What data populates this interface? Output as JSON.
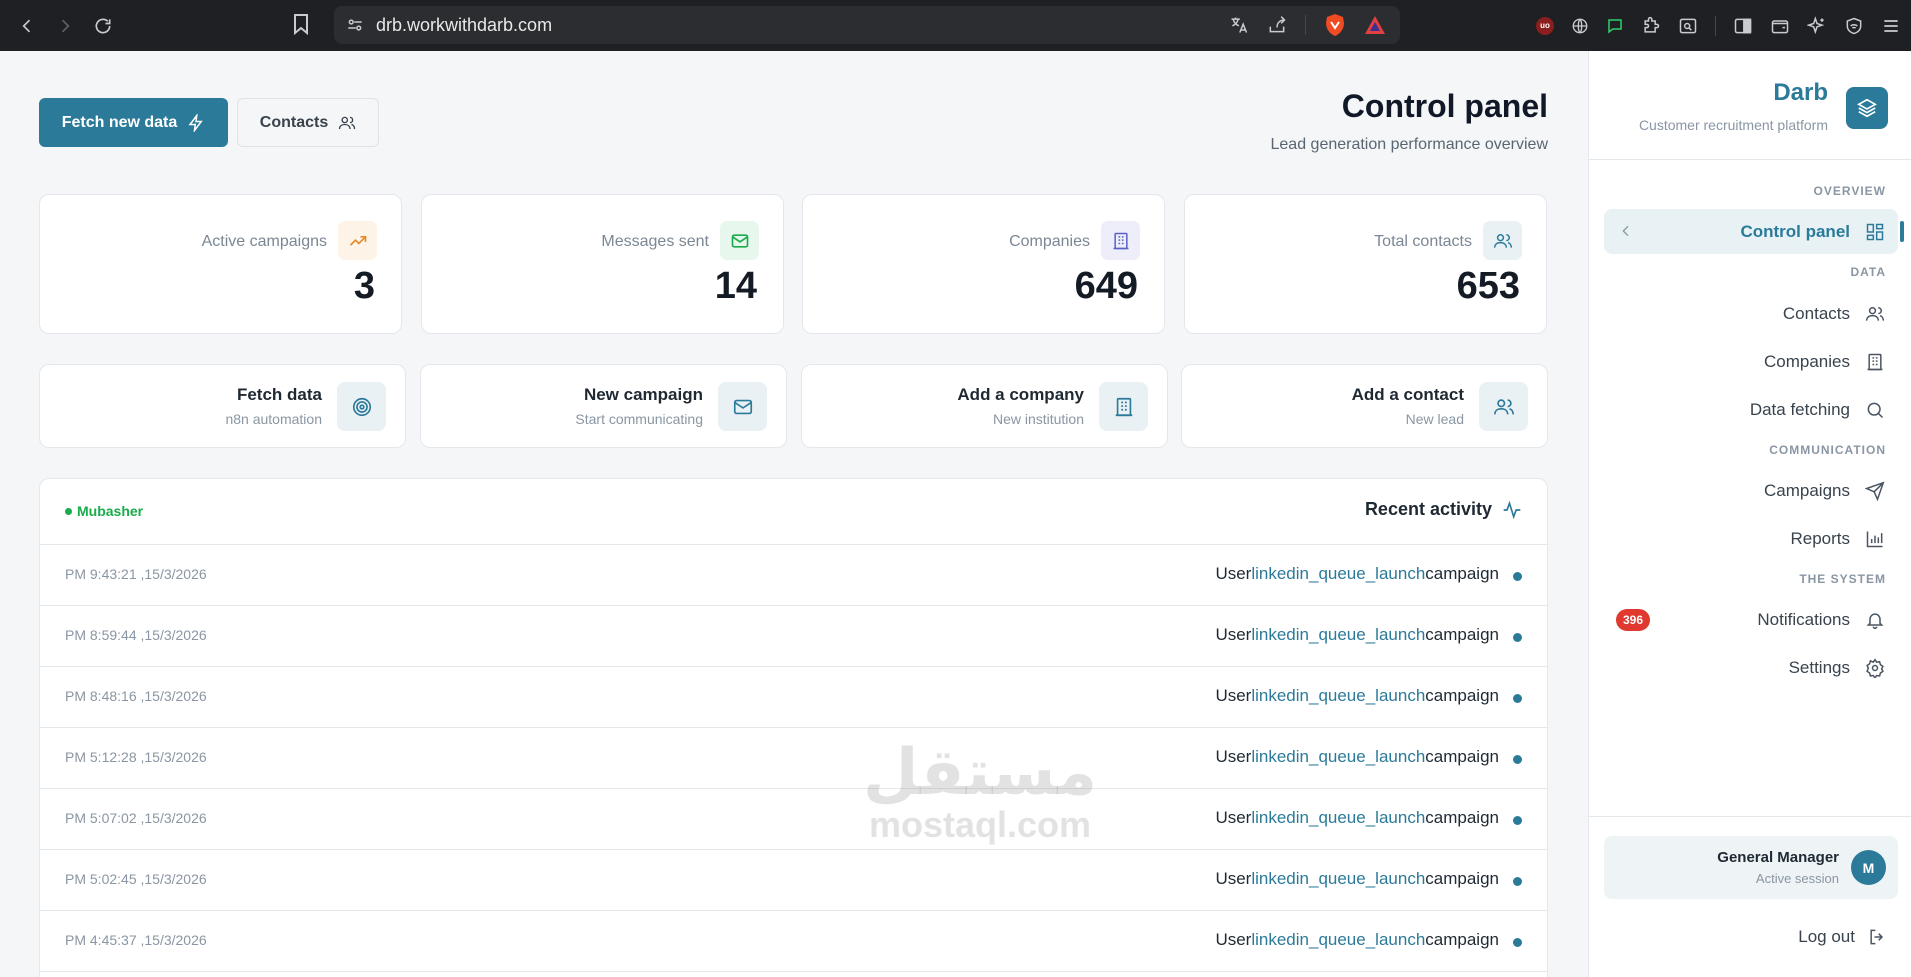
{
  "browser": {
    "url": "drb.workwithdarb.com",
    "extension_badge": "uo"
  },
  "toolbar": {
    "fetch_label": "Fetch new data",
    "contacts_label": "Contacts"
  },
  "header": {
    "title": "Control panel",
    "subtitle": "Lead generation performance overview"
  },
  "stats": [
    {
      "label": "Active campaigns",
      "value": "3",
      "icon": "trending-up-icon",
      "color": "#e58a2b",
      "bg": "#fdf3e7"
    },
    {
      "label": "Messages sent",
      "value": "14",
      "icon": "mail-icon",
      "color": "#1aab4b",
      "bg": "#e8f7ee"
    },
    {
      "label": "Companies",
      "value": "649",
      "icon": "building-icon",
      "color": "#5b5fc7",
      "bg": "#eeeefa"
    },
    {
      "label": "Total contacts",
      "value": "653",
      "icon": "users-icon",
      "color": "#2b7a99",
      "bg": "#eaf1f4"
    }
  ],
  "actions": [
    {
      "title": "Fetch data",
      "subtitle": "n8n automation",
      "icon": "target-icon"
    },
    {
      "title": "New campaign",
      "subtitle": "Start communicating",
      "icon": "mail-icon"
    },
    {
      "title": "Add a company",
      "subtitle": "New institution",
      "icon": "building-icon"
    },
    {
      "title": "Add a contact",
      "subtitle": "New lead",
      "icon": "users-icon"
    }
  ],
  "activity": {
    "title": "Recent activity",
    "live_label": "Mubasher",
    "rows": [
      {
        "time": "PM 9:43:21 ,15/3/2026",
        "pre": "User",
        "link": "linkedin_queue_launch",
        "post": "campaign"
      },
      {
        "time": "PM 8:59:44 ,15/3/2026",
        "pre": "User",
        "link": "linkedin_queue_launch",
        "post": "campaign"
      },
      {
        "time": "PM 8:48:16 ,15/3/2026",
        "pre": "User",
        "link": "linkedin_queue_launch",
        "post": "campaign"
      },
      {
        "time": "PM 5:12:28 ,15/3/2026",
        "pre": "User",
        "link": "linkedin_queue_launch",
        "post": "campaign"
      },
      {
        "time": "PM 5:07:02 ,15/3/2026",
        "pre": "User",
        "link": "linkedin_queue_launch",
        "post": "campaign"
      },
      {
        "time": "PM 5:02:45 ,15/3/2026",
        "pre": "User",
        "link": "linkedin_queue_launch",
        "post": "campaign"
      },
      {
        "time": "PM 4:45:37 ,15/3/2026",
        "pre": "User",
        "link": "linkedin_queue_launch",
        "post": "campaign"
      }
    ]
  },
  "watermark": {
    "arabic": "مستقل",
    "latin": "mostaql.com"
  },
  "sidebar": {
    "brand": "Darb",
    "tagline": "Customer recruitment platform",
    "sections": {
      "overview": "OVERVIEW",
      "data": "DATA",
      "communication": "COMMUNICATION",
      "system": "THE SYSTEM"
    },
    "items": {
      "control_panel": "Control panel",
      "contacts": "Contacts",
      "companies": "Companies",
      "data_fetching": "Data fetching",
      "campaigns": "Campaigns",
      "reports": "Reports",
      "notifications": "Notifications",
      "notifications_count": "396",
      "settings": "Settings"
    },
    "user": {
      "name": "General Manager",
      "status": "Active session",
      "initial": "M"
    },
    "logout": "Log out"
  },
  "colors": {
    "accent": "#2b7a99",
    "live": "#1aab4b",
    "badge": "#e0392f"
  }
}
